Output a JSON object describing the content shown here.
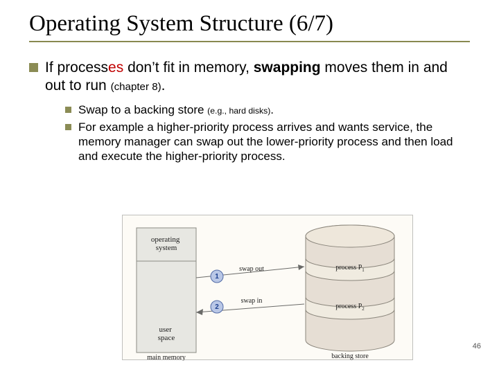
{
  "title": "Operating System Structure (6/7)",
  "main_bullet": {
    "pre": "If process",
    "red": "es",
    "mid": " don’t fit in memory, ",
    "strong": "swapping",
    "post1": " moves them in and out to run ",
    "small": "(chapter 8)",
    "post2": "."
  },
  "sub_bullets": {
    "b1": {
      "pre": "Swap to a backing store ",
      "small": "(e.g., hard disks)",
      "post": "."
    },
    "b2": "For example a higher-priority process arrives and wants service, the memory manager can swap out the lower-priority process and then load and execute the higher-priority process."
  },
  "diagram": {
    "os_label": "operating\nsystem",
    "swap_out": "swap out",
    "swap_in": "swap in",
    "user_space": "user\nspace",
    "main_memory": "main memory",
    "backing_store": "backing store",
    "p1": "process P",
    "p1sub": "1",
    "p2": "process P",
    "p2sub": "2",
    "num1": "1",
    "num2": "2"
  },
  "page_number": "46"
}
